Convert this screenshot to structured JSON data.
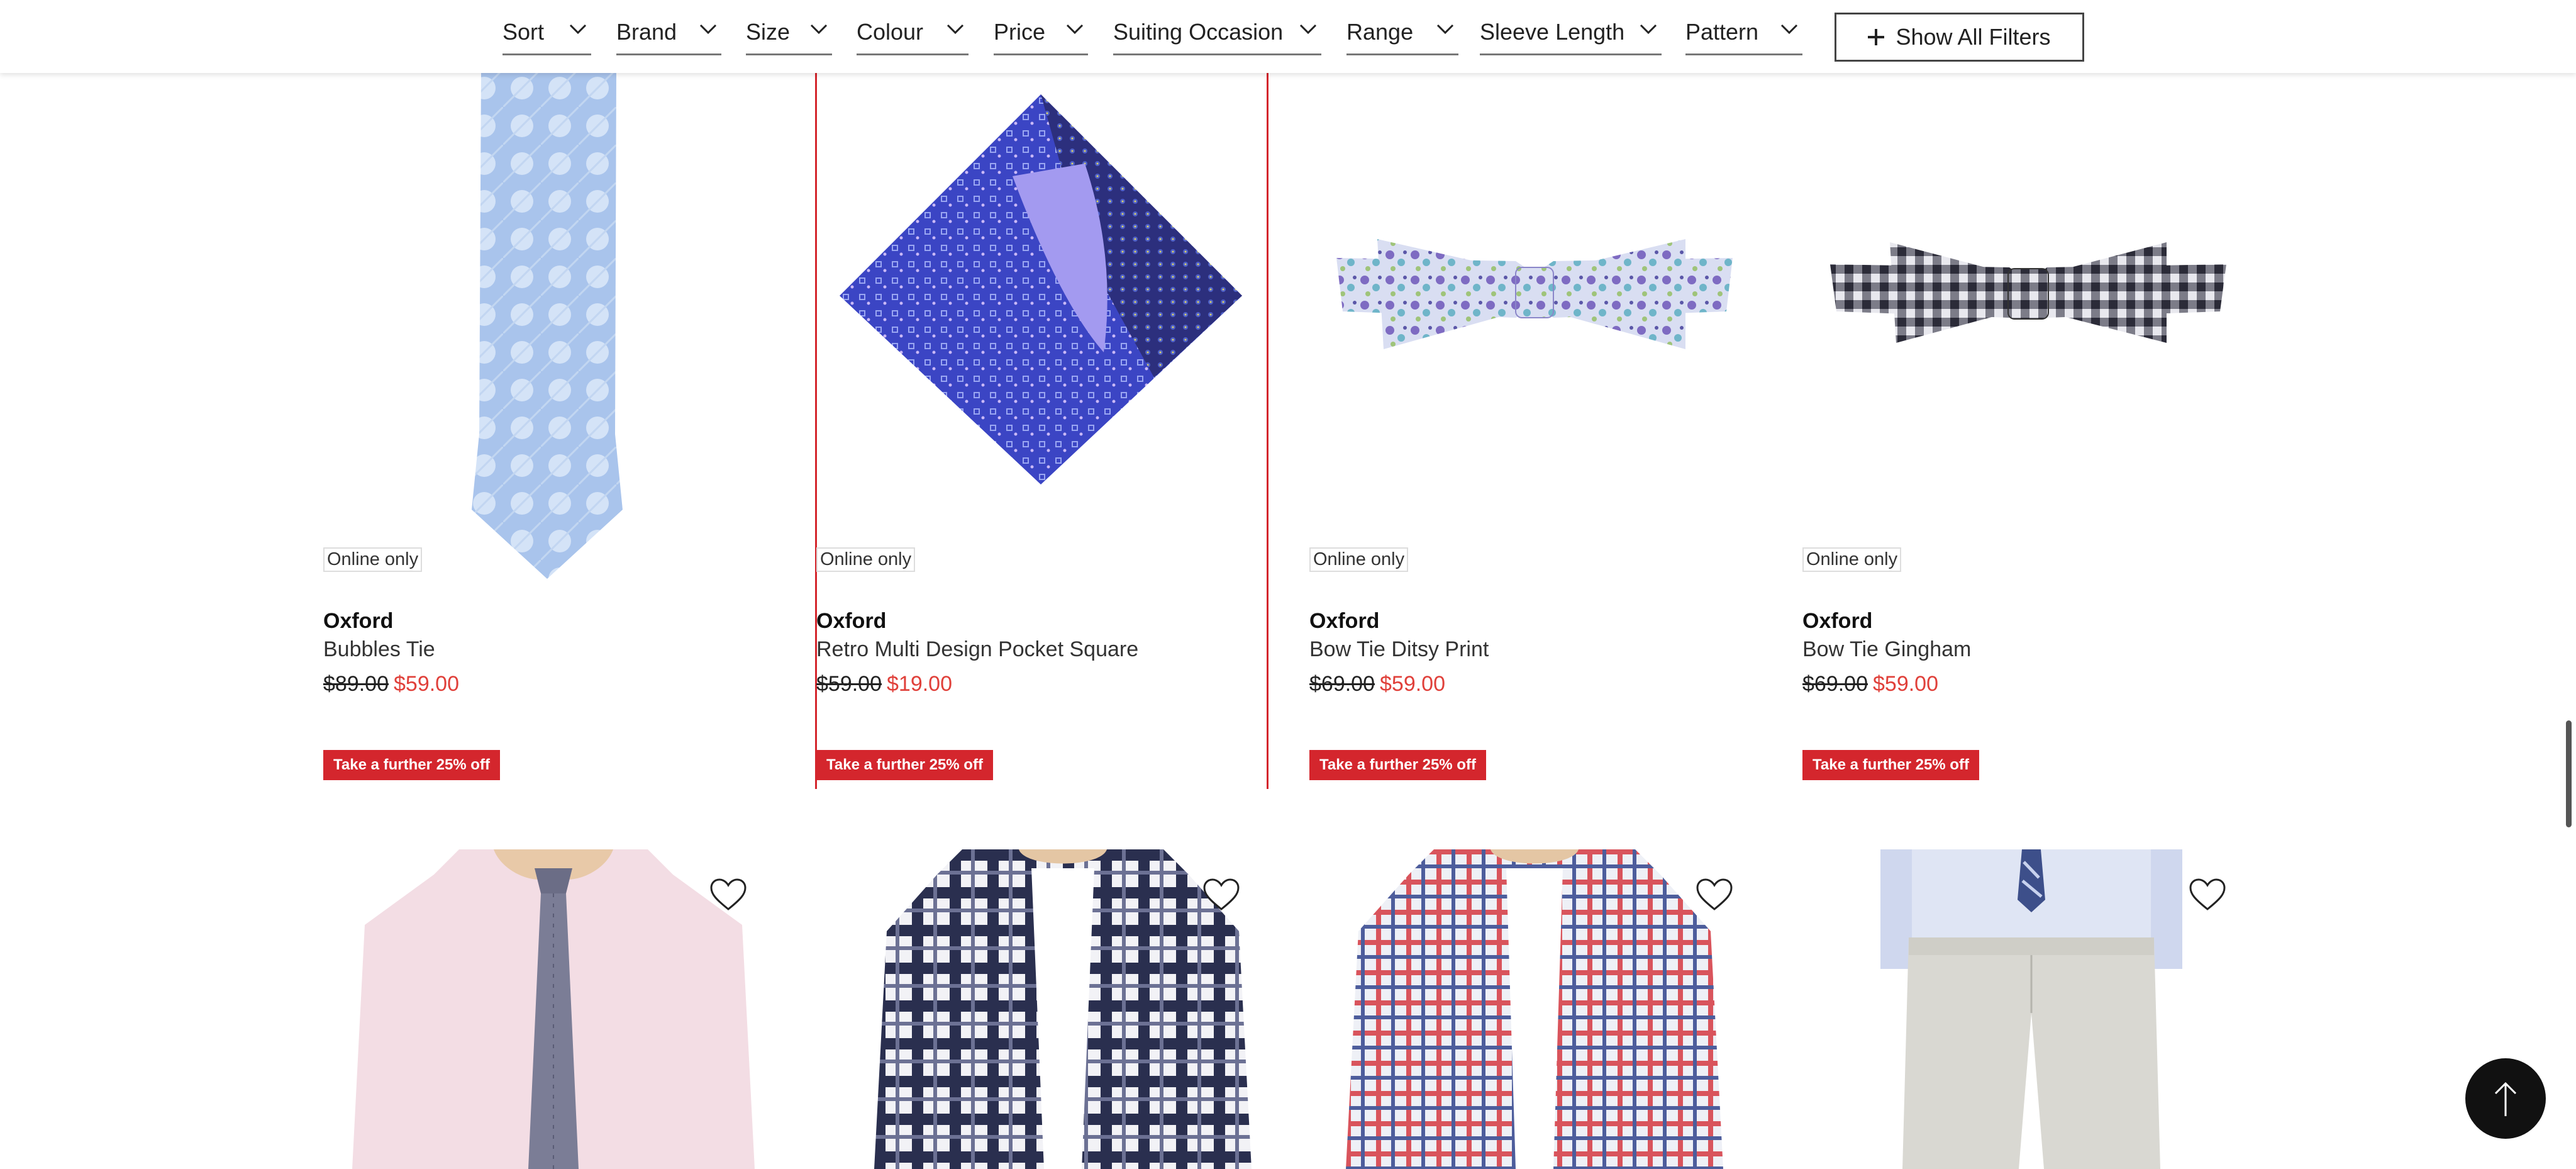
{
  "filters": {
    "items": [
      {
        "label": "Sort"
      },
      {
        "label": "Brand"
      },
      {
        "label": "Size"
      },
      {
        "label": "Colour"
      },
      {
        "label": "Price"
      },
      {
        "label": "Suiting Occasion"
      },
      {
        "label": "Range"
      },
      {
        "label": "Sleeve Length"
      },
      {
        "label": "Pattern"
      }
    ],
    "show_all_label": "Show All Filters"
  },
  "products": [
    {
      "badge": "Online only",
      "brand": "Oxford",
      "name": "Bubbles Tie",
      "old_price": "$89.00",
      "new_price": "$59.00",
      "promo": "Take a further 25% off"
    },
    {
      "badge": "Online only",
      "brand": "Oxford",
      "name": "Retro Multi Design Pocket Square",
      "old_price": "$59.00",
      "new_price": "$19.00",
      "promo": "Take a further 25% off"
    },
    {
      "badge": "Online only",
      "brand": "Oxford",
      "name": "Bow Tie Ditsy Print",
      "old_price": "$69.00",
      "new_price": "$59.00",
      "promo": "Take a further 25% off"
    },
    {
      "badge": "Online only",
      "brand": "Oxford",
      "name": "Bow Tie Gingham",
      "old_price": "$69.00",
      "new_price": "$59.00",
      "promo": "Take a further 25% off"
    }
  ],
  "colors": {
    "promo_bg": "#d4262d",
    "sale_price": "#e0403a",
    "hover_outline": "#d4262d",
    "back_to_top_bg": "#111111"
  },
  "icons": {
    "filter_chevron": "chevron-down-icon",
    "show_all": "plus-icon",
    "wishlist": "heart-icon",
    "back_to_top": "arrow-up-icon"
  }
}
